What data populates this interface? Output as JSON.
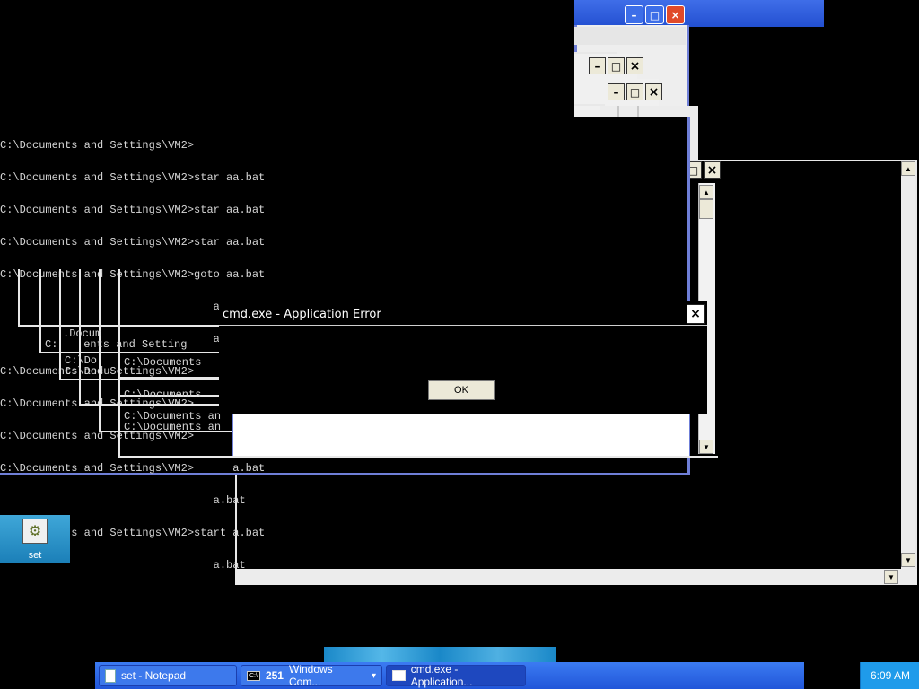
{
  "console": {
    "lines": [
      "C:\\Documents and Settings\\VM2>",
      "C:\\Documents and Settings\\VM2>star aa.bat",
      "C:\\Documents and Settings\\VM2>star aa.bat",
      "C:\\Documents and Settings\\VM2>star aa.bat",
      "C:\\Documents and Settings\\VM2>goto aa.bat",
      "                                 a.bat",
      "                                 a.bat",
      "C:\\Documents and Settings\\VM2>      a.bat",
      "C:\\Documents and Settings\\VM2>      a.bat",
      "C:\\Documents and Settings\\VM2>      a.bat",
      "C:\\Documents and Settings\\VM2>      a.bat",
      "                                 a.bat",
      "C:\\Documents and Settings\\VM2>start a.bat",
      "                                 a.bat"
    ],
    "fragments": [
      ".Docum",
      "C:    ents and Setting",
      "C:\\Do",
      "C:\\Docu",
      "C:\\Documents",
      "C:\\Documents",
      "C:\\Documents an",
      "C:\\Documents an"
    ]
  },
  "dialog": {
    "title": "cmd.exe - Application Error",
    "ok_label": "OK",
    "close_glyph": "×"
  },
  "window_caption": {
    "minimize": "–",
    "maximize": "□",
    "close": "×"
  },
  "desktop": {
    "icon_label": "set"
  },
  "taskbar": {
    "items": [
      {
        "label": "set - Notepad"
      },
      {
        "label": "Windows Com...",
        "count": "251",
        "icon": "C:\\"
      },
      {
        "label": "cmd.exe - Application..."
      }
    ],
    "dropdown_glyph": "▾",
    "clock": "6:09 AM"
  },
  "colors": {
    "desktop": "#000000",
    "window_border": "#6f7fd7",
    "xp_blue": "#2156d9",
    "tray": "#1f9bea"
  }
}
